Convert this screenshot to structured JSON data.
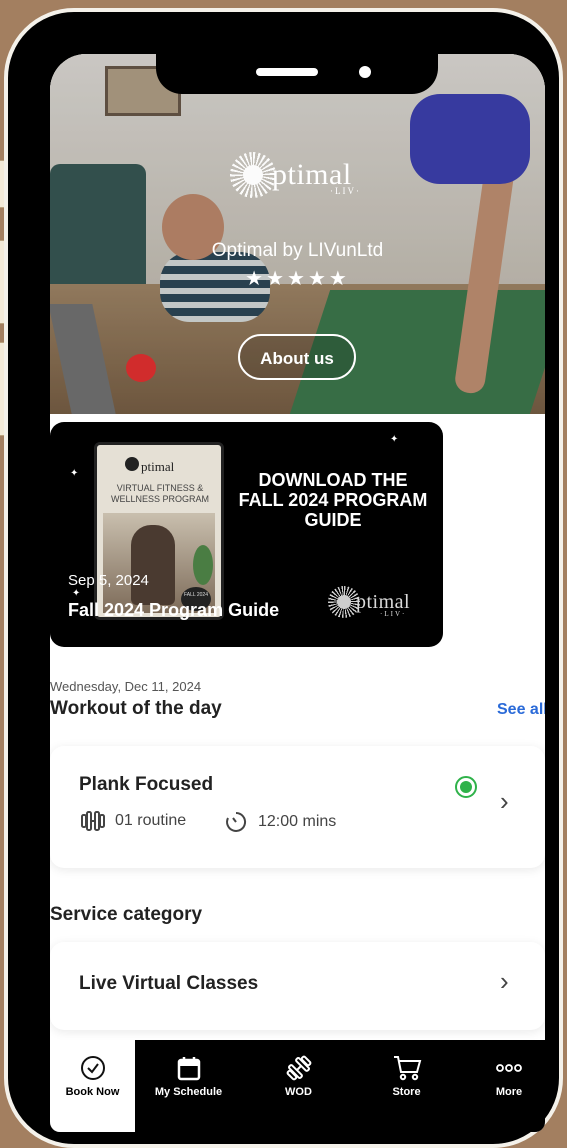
{
  "hero": {
    "logo_text": "ptimal",
    "logo_sub": "·LIV·",
    "brand_name": "Optimal by LIVunLtd",
    "stars": "★★★★★",
    "about_label": "About us"
  },
  "promo": {
    "tablet_logo": "ptimal",
    "tablet_sub": "VIRTUAL FITNESS & WELLNESS PROGRAM",
    "tablet_tag": "FALL 2024",
    "headline": "DOWNLOAD THE FALL 2024 PROGRAM GUIDE",
    "date": "Sep 5, 2024",
    "title": "Fall 2024 Program Guide",
    "logo_text": "ptimal",
    "logo_sub": "·LIV·"
  },
  "wod": {
    "date": "Wednesday, Dec 11, 2024",
    "heading": "Workout of the day",
    "see_all": "See all",
    "workout": {
      "name": "Plank Focused",
      "routines": "01 routine",
      "duration": "12:00 mins",
      "status_color": "#2fb24a"
    }
  },
  "services": {
    "heading": "Service category",
    "items": [
      {
        "label": "Live Virtual Classes"
      }
    ]
  },
  "nav": {
    "items": [
      {
        "label": "Book Now",
        "icon": "check-circle-icon",
        "active": true
      },
      {
        "label": "My Schedule",
        "icon": "calendar-icon",
        "active": false
      },
      {
        "label": "WOD",
        "icon": "dumbbell-icon",
        "active": false
      },
      {
        "label": "Store",
        "icon": "cart-icon",
        "active": false
      },
      {
        "label": "More",
        "icon": "more-icon",
        "active": false
      }
    ]
  },
  "colors": {
    "accent": "#2a6ad8",
    "nav_bg": "#000000",
    "frame_bg": "#a37f60"
  }
}
